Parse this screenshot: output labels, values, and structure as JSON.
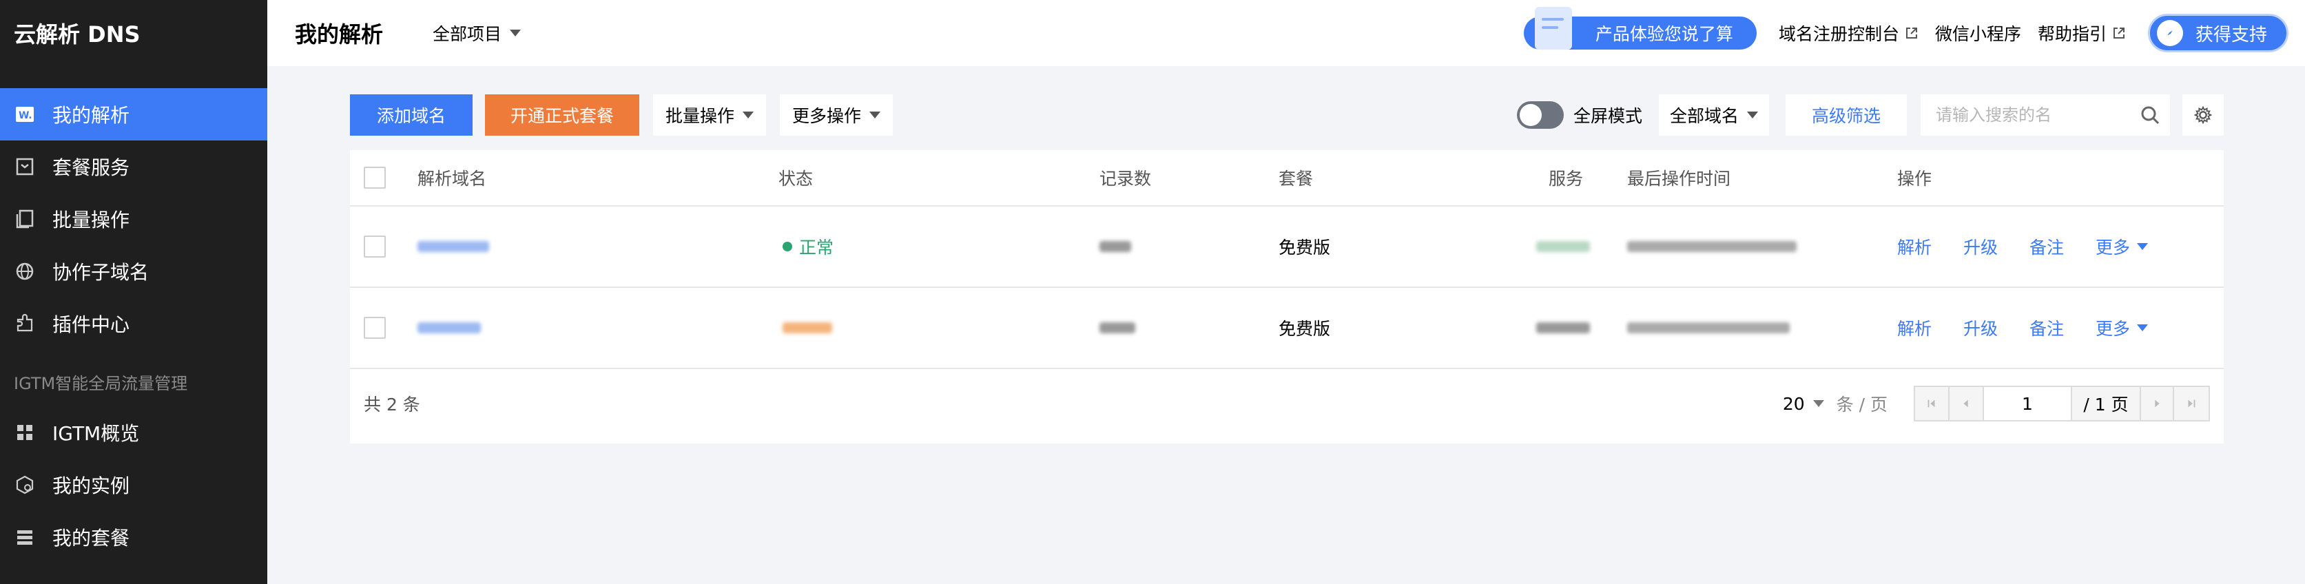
{
  "sidebar": {
    "brand": "云解析 DNS",
    "items": [
      {
        "label": "我的解析",
        "icon": "web-icon",
        "active": true
      },
      {
        "label": "套餐服务",
        "icon": "package-icon"
      },
      {
        "label": "批量操作",
        "icon": "copy-icon"
      },
      {
        "label": "协作子域名",
        "icon": "globe-icon"
      },
      {
        "label": "插件中心",
        "icon": "plugin-icon"
      }
    ],
    "group_title": "IGTM智能全局流量管理",
    "group_items": [
      {
        "label": "IGTM概览",
        "icon": "grid-icon"
      },
      {
        "label": "我的实例",
        "icon": "instance-icon"
      },
      {
        "label": "我的套餐",
        "icon": "list-icon"
      }
    ]
  },
  "header": {
    "title": "我的解析",
    "project_select": "全部项目",
    "promo": "产品体验您说了算",
    "links": [
      "域名注册控制台",
      "微信小程序",
      "帮助指引"
    ],
    "support": "获得支持"
  },
  "toolbar": {
    "add_domain": "添加域名",
    "open_package": "开通正式套餐",
    "batch_ops": "批量操作",
    "more_ops": "更多操作",
    "fullscreen": "全屏模式",
    "domain_filter": "全部域名",
    "advanced_filter": "高级筛选",
    "search_placeholder": "请输入搜索的名"
  },
  "table": {
    "columns": [
      "解析域名",
      "状态",
      "记录数",
      "套餐",
      "服务",
      "最后操作时间",
      "操作"
    ],
    "rows": [
      {
        "status": "正常",
        "package": "免费版"
      },
      {
        "status": "",
        "package": "免费版"
      }
    ],
    "actions": [
      "解析",
      "升级",
      "备注",
      "更多"
    ]
  },
  "pagination": {
    "total": "共 2 条",
    "page_size": "20",
    "per_page_label": "条 / 页",
    "current_page": "1",
    "total_pages": "/ 1 页"
  },
  "colors": {
    "primary": "#3d7bf6",
    "orange": "#ef7b3a",
    "sidebar": "#1f1f1f",
    "success": "#2ba471"
  }
}
